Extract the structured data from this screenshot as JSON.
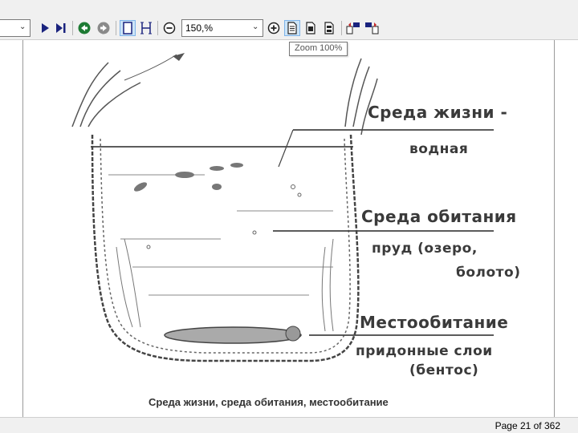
{
  "toolbar": {
    "zoom_value": "150,%",
    "tooltip": "Zoom 100%"
  },
  "illustration": {
    "labels": {
      "habitat_env": "Среда жизни -",
      "aquatic": "водная",
      "living_env": "Среда обитания",
      "pond": "пруд (озеро,",
      "swamp": "болото)",
      "location": "Местообитание",
      "bottom_layers": "придонные слои",
      "benthos": "(бентос)"
    },
    "caption": "Среда жизни, среда обитания, местообитание"
  },
  "status": {
    "page_info": "Page 21 of 362"
  },
  "colors": {
    "toolbar_bg": "#f0f0f0",
    "active_btn": "#cce4f7",
    "icon_green": "#1e7b34",
    "icon_gray": "#8a8a8a",
    "icon_navy": "#1a237e"
  }
}
